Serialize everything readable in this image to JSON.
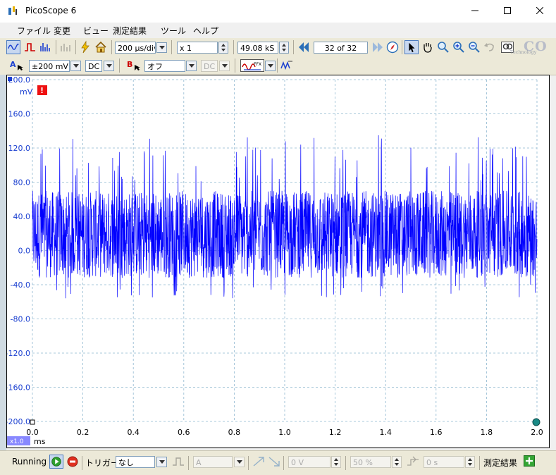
{
  "window": {
    "title": "PicoScope 6"
  },
  "menu": [
    "ファイル",
    "変更",
    "ビュー",
    "測定結果",
    "ツール",
    "ヘルプ"
  ],
  "toolbar1": {
    "timebase": "200 µs/div",
    "zoom": "x 1",
    "samples": "49.08 kS",
    "buffer": "32 of 32",
    "logo": "CO",
    "logo_sub": "Technology"
  },
  "toolbar2": {
    "chA_label": "A",
    "chA_range": "±200 mV",
    "chA_coupling": "DC",
    "chB_label": "B",
    "chB_range": "オフ",
    "chB_coupling": "DC"
  },
  "status": {
    "running": "Running",
    "trigger_label": "トリガー",
    "trigger_mode": "なし",
    "trigger_source": "A",
    "threshold": "0 V",
    "pretrigger": "50 %",
    "delay": "0 s",
    "measurements": "測定結果"
  },
  "colors": {
    "trace": "#0000ff",
    "grid": "#8fb8d0",
    "accent": "#2b84a0"
  },
  "chart_data": {
    "type": "line",
    "xlabel": "ms",
    "ylabel": "mV",
    "xlim": [
      0.0,
      2.0
    ],
    "ylim": [
      -200.0,
      200.0
    ],
    "x_ticks": [
      "0.0",
      "0.2",
      "0.4",
      "0.6",
      "0.8",
      "1.0",
      "1.2",
      "1.4",
      "1.6",
      "1.8",
      "2.0"
    ],
    "y_ticks": [
      "200.0",
      "160.0",
      "120.0",
      "80.0",
      "40.0",
      "0.0",
      "-40.0",
      "-80.0",
      "-120.0",
      "-160.0",
      "-200.0"
    ],
    "scale_badge": "x1.0",
    "grid": true,
    "series": [
      {
        "values_hint": "noise",
        "x_range": [
          0.0,
          2.0
        ],
        "band_mV": [
          -40,
          80
        ],
        "peak_max_mV": 140,
        "trough_min_mV": -60
      }
    ]
  }
}
